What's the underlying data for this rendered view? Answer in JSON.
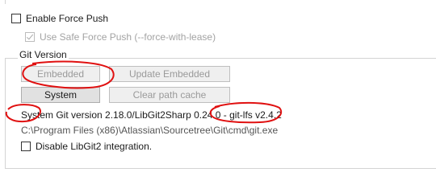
{
  "force_push": {
    "enable_label": "Enable Force Push",
    "enable_checked": false,
    "safe_label": "Use Safe Force Push (--force-with-lease)",
    "safe_checked": true
  },
  "git_version": {
    "group_title": "Git Version",
    "buttons": {
      "embedded": "Embedded",
      "update_embedded": "Update Embedded",
      "system": "System",
      "clear_cache": "Clear path cache"
    },
    "version_text": "System Git version 2.18.0/LibGit2Sharp 0.24.0 - git-lfs v2.4.2",
    "path_text": "C:\\Program Files (x86)\\Atlassian\\Sourcetree\\Git\\cmd\\git.exe",
    "disable_libgit2_label": "Disable LibGit2 integration.",
    "disable_libgit2_checked": false
  },
  "annotation_color": "#e01010"
}
